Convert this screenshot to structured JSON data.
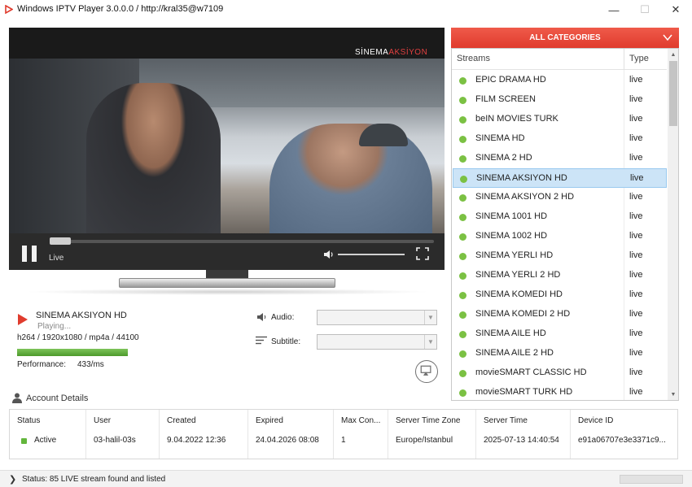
{
  "window": {
    "title": "Windows IPTV Player 3.0.0.0 / http://kral35@w7109",
    "minimize_glyph": "—",
    "maximize_glyph": "☐",
    "close_glyph": "✕"
  },
  "player": {
    "channel_logo_main": "SİNEMA",
    "channel_logo_accent": "AKSİYON",
    "live_label": "Live",
    "icons": {
      "pause": "pause-icon",
      "volume": "volume-icon",
      "fullscreen": "fullscreen-icon"
    }
  },
  "now_playing": {
    "title": "SINEMA AKSIYON HD",
    "status": "Playing...",
    "codec": "h264 / 1920x1080 / mp4a / 44100",
    "performance_label": "Performance:",
    "performance_value": "433/ms",
    "performance_level": 1.0
  },
  "audio": {
    "label": "Audio:",
    "selected": ""
  },
  "subtitle": {
    "label": "Subtitle:",
    "selected": ""
  },
  "categories": {
    "header": "ALL CATEGORIES",
    "columns": {
      "name": "Streams",
      "type": "Type"
    },
    "streams": [
      {
        "name": "EPIC DRAMA HD",
        "type": "live"
      },
      {
        "name": "FILM SCREEN",
        "type": "live"
      },
      {
        "name": "beIN MOVIES TURK",
        "type": "live"
      },
      {
        "name": "SINEMA HD",
        "type": "live"
      },
      {
        "name": "SINEMA 2 HD",
        "type": "live"
      },
      {
        "name": "SINEMA AKSIYON HD",
        "type": "live",
        "selected": true
      },
      {
        "name": "SINEMA AKSIYON 2 HD",
        "type": "live"
      },
      {
        "name": "SINEMA 1001 HD",
        "type": "live"
      },
      {
        "name": "SINEMA 1002 HD",
        "type": "live"
      },
      {
        "name": "SINEMA YERLI HD",
        "type": "live"
      },
      {
        "name": "SINEMA YERLI 2 HD",
        "type": "live"
      },
      {
        "name": "SINEMA KOMEDI HD",
        "type": "live"
      },
      {
        "name": "SINEMA KOMEDI 2 HD",
        "type": "live"
      },
      {
        "name": "SINEMA AILE HD",
        "type": "live"
      },
      {
        "name": "SINEMA AILE 2 HD",
        "type": "live"
      },
      {
        "name": "movieSMART CLASSIC HD",
        "type": "live"
      },
      {
        "name": "movieSMART TURK HD",
        "type": "live"
      }
    ]
  },
  "account": {
    "title": "Account Details",
    "columns": [
      {
        "header": "Status",
        "value": "Active"
      },
      {
        "header": "User",
        "value": "03-halil-03s"
      },
      {
        "header": "Created",
        "value": "9.04.2022 12:36"
      },
      {
        "header": "Expired",
        "value": "24.04.2026 08:08"
      },
      {
        "header": "Max Con...",
        "value": "1"
      },
      {
        "header": "Server Time Zone",
        "value": "Europe/Istanbul"
      },
      {
        "header": "Server Time",
        "value": "2025-07-13 14:40:54"
      },
      {
        "header": "Device ID",
        "value": "e91a06707e3e3371c9..."
      }
    ]
  },
  "statusbar": {
    "text": "Status: 85 LIVE stream found and listed"
  },
  "colors": {
    "accent": "#e03b2d",
    "live_dot": "#7bc143",
    "selection": "#cce4f7"
  }
}
